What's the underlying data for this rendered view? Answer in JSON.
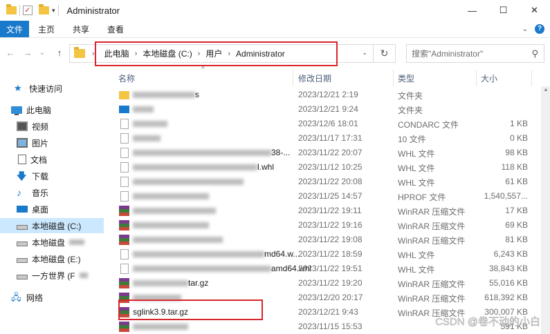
{
  "window": {
    "title": "Administrator",
    "min_glyph": "—",
    "max_glyph": "☐",
    "close_glyph": "✕",
    "quick_check_glyph": "✓",
    "quick_dd_glyph": "▾"
  },
  "ribbon": {
    "tabs": [
      "文件",
      "主页",
      "共享",
      "查看"
    ],
    "collapse_glyph": "⌄",
    "help_glyph": "?"
  },
  "nav": {
    "back_glyph": "←",
    "forward_glyph": "→",
    "dropdown_glyph": "⌄",
    "up_glyph": "↑",
    "breadcrumb": [
      "此电脑",
      "本地磁盘 (C:)",
      "用户",
      "Administrator"
    ],
    "crumb_separator": "›",
    "addr_dropdown_glyph": "⌄",
    "refresh_glyph": "↻",
    "search_placeholder": "搜索\"Administrator\"",
    "search_glyph": "⚲"
  },
  "sidebar": {
    "items": [
      {
        "label": "快速访问",
        "icon": "star-icon"
      },
      {
        "label": "此电脑",
        "icon": "computer-icon"
      },
      {
        "label": "视频",
        "icon": "video-icon"
      },
      {
        "label": "图片",
        "icon": "pictures-icon"
      },
      {
        "label": "文档",
        "icon": "documents-icon"
      },
      {
        "label": "下载",
        "icon": "download-icon"
      },
      {
        "label": "音乐",
        "icon": "music-icon"
      },
      {
        "label": "桌面",
        "icon": "desktop-icon"
      },
      {
        "label": "本地磁盘 (C:)",
        "icon": "drive-icon",
        "selected": true
      },
      {
        "label": "本地磁盘",
        "icon": "drive-icon"
      },
      {
        "label": "本地磁盘 (E:)",
        "icon": "drive-icon"
      },
      {
        "label": "一方世界 (F",
        "icon": "drive-icon"
      },
      {
        "label": "网络",
        "icon": "network-icon"
      }
    ]
  },
  "columns": {
    "name": "名称",
    "date": "修改日期",
    "type": "类型",
    "size": "大小",
    "sort_glyph": "^"
  },
  "files": [
    {
      "name": "s",
      "date": "2023/12/21 2:19",
      "type": "文件夹",
      "size": "",
      "icon": "folder"
    },
    {
      "name": "",
      "date": "2023/12/21 9:24",
      "type": "文件夹",
      "size": "",
      "icon": "blue"
    },
    {
      "name": "",
      "date": "2023/12/6 18:01",
      "type": "CONDARC 文件",
      "size": "1 KB",
      "icon": "file"
    },
    {
      "name": "",
      "date": "2023/11/17 17:31",
      "type": "10 文件",
      "size": "0 KB",
      "icon": "file"
    },
    {
      "name": "38-...",
      "date": "2023/11/22 20:07",
      "type": "WHL 文件",
      "size": "98 KB",
      "icon": "file"
    },
    {
      "name": "l.whl",
      "date": "2023/11/12 10:25",
      "type": "WHL 文件",
      "size": "118 KB",
      "icon": "file"
    },
    {
      "name": "",
      "date": "2023/11/22 20:08",
      "type": "WHL 文件",
      "size": "61 KB",
      "icon": "file"
    },
    {
      "name": "",
      "date": "2023/11/25 14:57",
      "type": "HPROF 文件",
      "size": "1,540,557...",
      "icon": "file"
    },
    {
      "name": "",
      "date": "2023/11/22 19:11",
      "type": "WinRAR 压缩文件",
      "size": "17 KB",
      "icon": "rar"
    },
    {
      "name": "",
      "date": "2023/11/22 19:16",
      "type": "WinRAR 压缩文件",
      "size": "69 KB",
      "icon": "rar"
    },
    {
      "name": "",
      "date": "2023/11/22 19:08",
      "type": "WinRAR 压缩文件",
      "size": "81 KB",
      "icon": "rar"
    },
    {
      "name": "md64.w...",
      "date": "2023/11/22 18:59",
      "type": "WHL 文件",
      "size": "6,243 KB",
      "icon": "file"
    },
    {
      "name": "amd64.whl",
      "date": "2023/11/22 19:51",
      "type": "WHL 文件",
      "size": "38,843 KB",
      "icon": "file"
    },
    {
      "name": "tar.gz",
      "date": "2023/11/22 19:20",
      "type": "WinRAR 压缩文件",
      "size": "55,016 KB",
      "icon": "rar"
    },
    {
      "name": "",
      "date": "2023/12/20 20:17",
      "type": "WinRAR 压缩文件",
      "size": "618,392 KB",
      "icon": "rar"
    },
    {
      "name": "sglink3.9.tar.gz",
      "date": "2023/12/21 9:43",
      "type": "WinRAR 压缩文件",
      "size": "300,007 KB",
      "icon": "rar"
    },
    {
      "name": "",
      "date": "2023/11/15 15:53",
      "type": "",
      "size": "591 KB",
      "icon": "rar"
    }
  ],
  "watermark": "CSDN @卷不动的小白"
}
